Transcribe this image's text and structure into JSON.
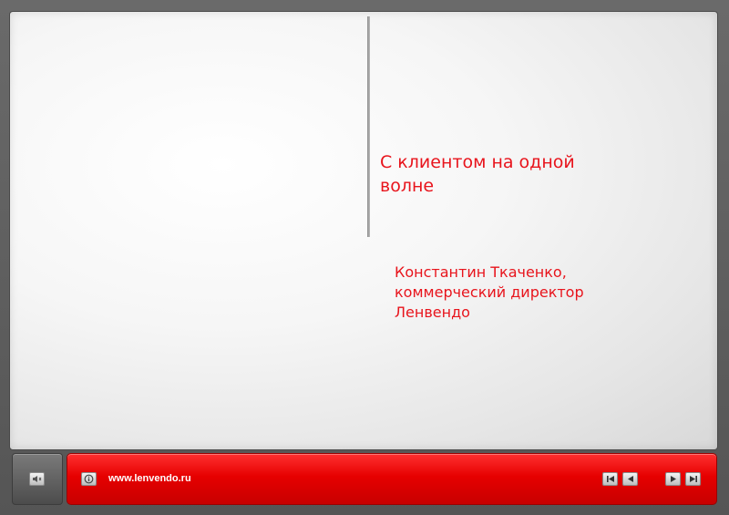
{
  "slide": {
    "title": "С клиентом на одной волне",
    "subtitle_lines": [
      "Константин Ткаченко,",
      "коммерческий директор",
      "Ленвендо"
    ]
  },
  "navigation": {
    "website": "www.lenvendo.ru",
    "icons": [
      "speaker-icon",
      "info-icon",
      "first-slide-icon",
      "previous-slide-icon",
      "next-slide-icon",
      "last-slide-icon"
    ]
  },
  "colors": {
    "accent_red": "#e8141c",
    "nav_bar_red": "#e60000",
    "frame_gray": "#5f5f5f"
  }
}
